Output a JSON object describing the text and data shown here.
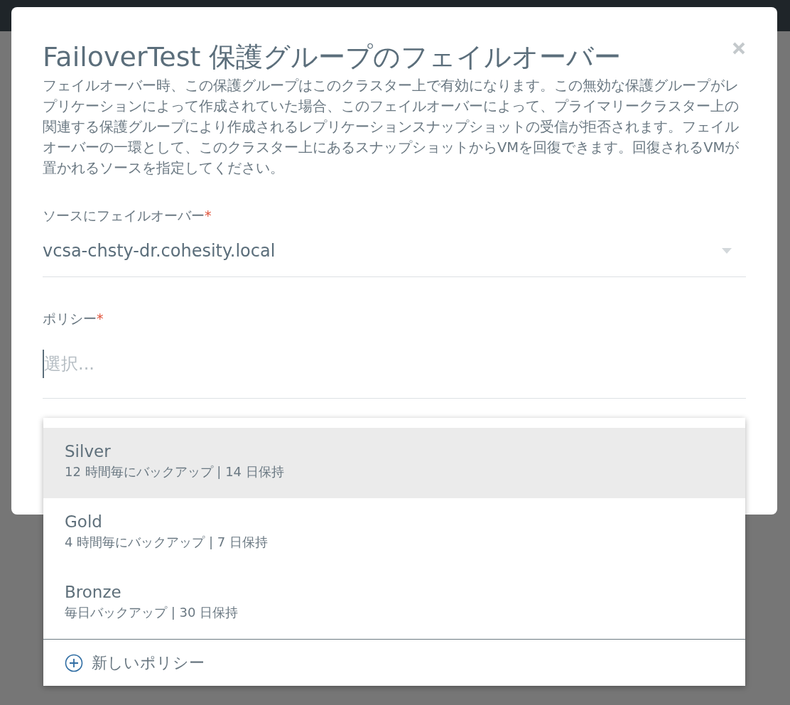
{
  "dialog": {
    "title": "FailoverTest 保護グループのフェイルオーバー",
    "description": "フェイルオーバー時、この保護グループはこのクラスター上で有効になります。この無効な保護グループがレプリケーションによって作成されていた場合、このフェイルオーバーによって、プライマリークラスター上の関連する保護グループにより作成されるレプリケーションスナップショットの受信が拒否されます。フェイルオーバーの一環として、このクラスター上にあるスナップショットからVMを回復できます。回復されるVMが置かれるソースを指定してください。",
    "fields": [
      {
        "kind": "select",
        "label": "ソースにフェイルオーバー",
        "required_mark": "*",
        "value": "vcsa-chsty-dr.cohesity.local"
      },
      {
        "kind": "input",
        "label": "ポリシー",
        "required_mark": "*",
        "placeholder": "選択..."
      }
    ]
  },
  "policy_menu": {
    "options": [
      {
        "name": "Silver",
        "detail": "12 時間毎にバックアップ | 14 日保持",
        "selected": true
      },
      {
        "name": "Gold",
        "detail": "4 時間毎にバックアップ | 7 日保持",
        "selected": false
      },
      {
        "name": "Bronze",
        "detail": "毎日バックアップ | 30 日保持",
        "selected": false
      }
    ],
    "new_label": "新しいポリシー"
  }
}
